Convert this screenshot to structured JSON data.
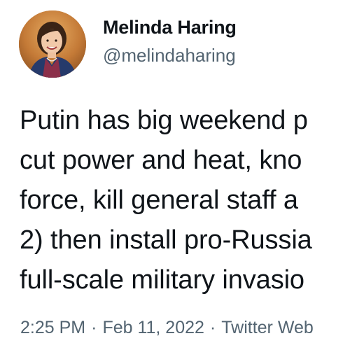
{
  "author": {
    "name": "Melinda Haring",
    "handle": "@melindaharing"
  },
  "tweet": {
    "lines": [
      "Putin has big weekend p",
      "cut power and heat, kno",
      "force, kill general staff a",
      "2) then install pro-Russia",
      "full-scale military invasio"
    ]
  },
  "meta": {
    "time": "2:25 PM",
    "separator": "·",
    "date": "Feb 11, 2022",
    "source": "Twitter Web"
  },
  "colors": {
    "text": "#0f1419",
    "secondary": "#536471",
    "background": "#ffffff"
  }
}
